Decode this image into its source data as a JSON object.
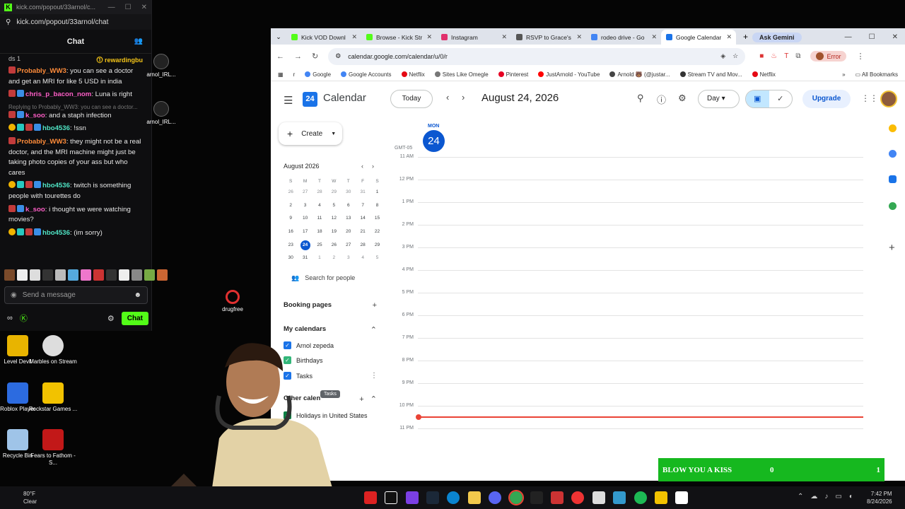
{
  "kick": {
    "window_url_title": "kick.com/popout/33arnol/c...",
    "url": "kick.com/popout/33arnol/chat",
    "chat_title": "Chat",
    "pinned_left": "ds 1",
    "pinned_right": "rewardingbu",
    "messages": [
      {
        "user": "Probably_WW3",
        "text": ": you can see a doctor and get an MRI for like 5 USD in india",
        "color": "orange"
      },
      {
        "user": "chris_p_bacon_nom",
        "text": ": Luna is right",
        "color": "pink"
      },
      {
        "reply": "Replying to Probably_WW3: you can see a doctor...",
        "user": "k_soo",
        "text": ": and a staph infection",
        "color": "pink"
      },
      {
        "user": "hbo4536",
        "text": ": !ssn",
        "color": "teal"
      },
      {
        "user": "Probably_WW3",
        "text": ": they might not be a real doctor, and the MRI machine might just be taking photo copies of your ass but who cares",
        "color": "orange"
      },
      {
        "user": "hbo4536",
        "text": ": twitch is something people with tourettes do",
        "color": "teal"
      },
      {
        "user": "k_soo",
        "text": ": i thought we were watching movies?",
        "color": "pink"
      },
      {
        "user": "hbo4536",
        "text": ": (im sorry)",
        "color": "teal"
      }
    ],
    "send_placeholder": "Send a message",
    "chat_button": "Chat"
  },
  "desktop": {
    "icons": [
      {
        "label": "arnol_IRL...",
        "icon": "video-file-icon"
      },
      {
        "label": "arnol_IRL...",
        "icon": "video-file-icon"
      },
      {
        "label": "drugfree",
        "icon": "no-sign-icon"
      },
      {
        "label": "Level Devil",
        "icon": "game-icon"
      },
      {
        "label": "Marbles on Stream",
        "icon": "marble-icon"
      },
      {
        "label": "Roblox Player",
        "icon": "roblox-icon"
      },
      {
        "label": "Rockstar Games ...",
        "icon": "rockstar-icon"
      },
      {
        "label": "Recycle Bin",
        "icon": "recycle-bin-icon"
      },
      {
        "label": "Fears to Fathom - S...",
        "icon": "game-icon"
      }
    ]
  },
  "browser": {
    "tabs": [
      {
        "label": "Kick VOD Downl",
        "fav": "#53fc18"
      },
      {
        "label": "Browse - Kick Str",
        "fav": "#53fc18"
      },
      {
        "label": "Instagram",
        "fav": "#e1306c"
      },
      {
        "label": "RSVP to Grace's",
        "fav": "#555555"
      },
      {
        "label": "rodeo drive - Go",
        "fav": "#4285f4"
      },
      {
        "label": "Google Calendar",
        "fav": "#1a73e8"
      }
    ],
    "ask_gemini": "Ask Gemini",
    "url": "calendar.google.com/calendar/u/0/r",
    "error_label": "Error",
    "bookmarks": [
      "r",
      "Google",
      "Google Accounts",
      "Netflix",
      "Sites Like Omegle",
      "Pinterest",
      "JustArnold - YouTube",
      "Arnold 🐻 (@justar...",
      "Stream TV and Mov...",
      "Netflix"
    ],
    "all_bookmarks": "All Bookmarks"
  },
  "calendar": {
    "app_name": "Calendar",
    "logo_num": "24",
    "today": "Today",
    "date_title": "August 24, 2026",
    "view": "Day",
    "upgrade": "Upgrade",
    "create": "Create",
    "mini_month": "August 2026",
    "weekdays": [
      "S",
      "M",
      "T",
      "W",
      "T",
      "F",
      "S"
    ],
    "weeks": [
      [
        "26",
        "27",
        "28",
        "29",
        "30",
        "31",
        "1"
      ],
      [
        "2",
        "3",
        "4",
        "5",
        "6",
        "7",
        "8"
      ],
      [
        "9",
        "10",
        "11",
        "12",
        "13",
        "14",
        "15"
      ],
      [
        "16",
        "17",
        "18",
        "19",
        "20",
        "21",
        "22"
      ],
      [
        "23",
        "24",
        "25",
        "26",
        "27",
        "28",
        "29"
      ],
      [
        "30",
        "31",
        "1",
        "2",
        "3",
        "4",
        "5"
      ]
    ],
    "search_people": "Search for people",
    "booking_pages": "Booking pages",
    "my_calendars": "My calendars",
    "calendars": [
      {
        "name": "Arnol zepeda",
        "color": "#1a73e8"
      },
      {
        "name": "Birthdays",
        "color": "#33b679"
      },
      {
        "name": "Tasks",
        "color": "#1a73e8"
      }
    ],
    "tooltip": "Tasks",
    "other_calendars": "Other calen",
    "other": [
      {
        "name": "Holidays in United States",
        "color": "#0b8043"
      }
    ],
    "day_dow": "MON",
    "day_num": "24",
    "tz": "GMT-05",
    "hours": [
      "11 AM",
      "12 PM",
      "1 PM",
      "2 PM",
      "3 PM",
      "4 PM",
      "5 PM",
      "6 PM",
      "7 PM",
      "8 PM",
      "9 PM",
      "10 PM",
      "11 PM"
    ]
  },
  "overlay": {
    "label": "BLOW YOU A KISS",
    "count": "0",
    "right": "1"
  },
  "taskbar": {
    "temp": "80°F",
    "condition": "Clear",
    "time": "7:42 PM",
    "date": "8/24/2026"
  }
}
